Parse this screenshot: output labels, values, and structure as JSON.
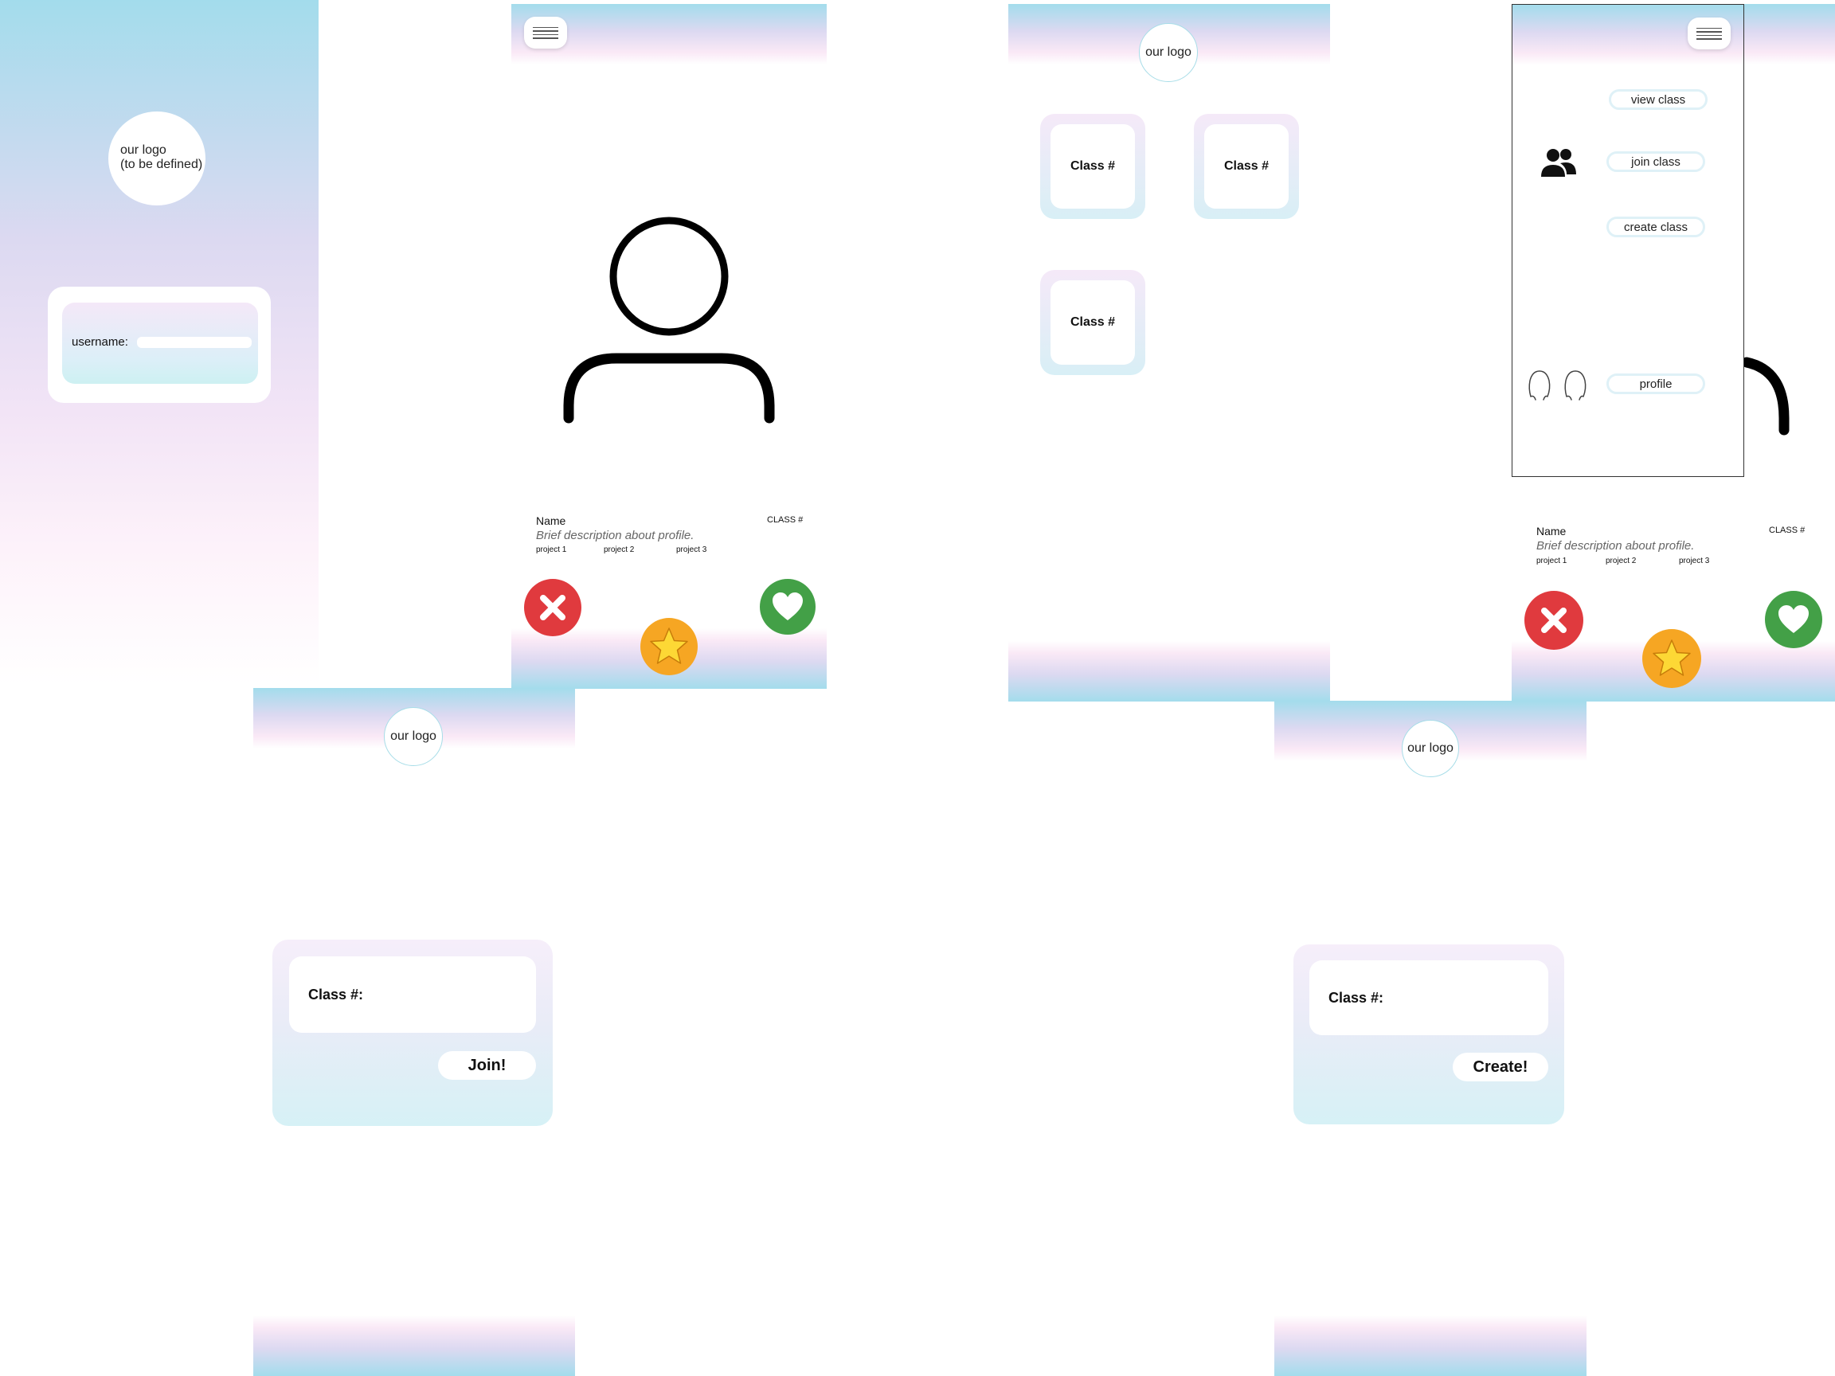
{
  "colors": {
    "accent_teal": "#a3dcec",
    "accent_lavender": "#dcd9f1",
    "accent_pink": "#fae9f6",
    "reject_red": "#e03a3e",
    "like_green": "#43a047",
    "star_orange": "#f6a623",
    "star_yellow": "#fdd835"
  },
  "login": {
    "logo_line1": "our logo",
    "logo_line2": "(to be defined)",
    "username_label": "username:"
  },
  "profile_screen": {
    "name": "Name",
    "class_tag": "CLASS #",
    "description": "Brief description about profile.",
    "projects": [
      "project 1",
      "project 2",
      "project 3"
    ],
    "icons": {
      "menu": "hamburger-menu-icon",
      "avatar": "user-avatar-icon",
      "reject": "x-icon",
      "favorite": "star-icon",
      "like": "heart-icon"
    }
  },
  "classes_screen": {
    "logo": "our logo",
    "cards": [
      "Class #",
      "Class #",
      "Class #"
    ]
  },
  "menu_screen": {
    "items": [
      "view class",
      "join class",
      "create class",
      "profile"
    ],
    "name": "Name",
    "class_tag": "CLASS #",
    "description": "Brief description about profile.",
    "projects": [
      "project 1",
      "project 2",
      "project 3"
    ]
  },
  "join_screen": {
    "logo": "our logo",
    "field_label": "Class #:",
    "button": "Join!"
  },
  "create_screen": {
    "logo": "our logo",
    "field_label": "Class #:",
    "button": "Create!"
  }
}
